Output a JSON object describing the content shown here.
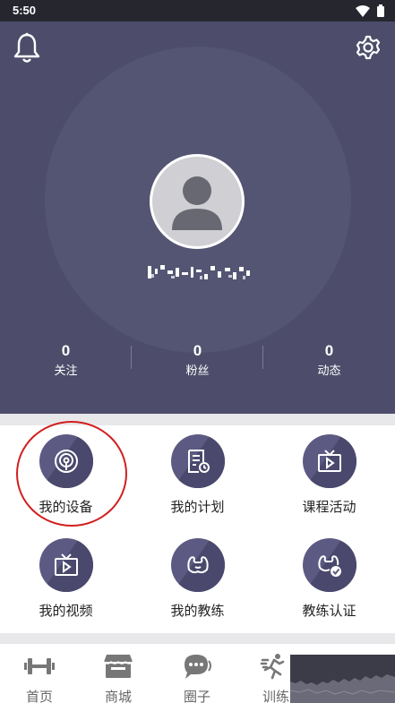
{
  "status_bar": {
    "time": "5:50"
  },
  "profile": {
    "stats": [
      {
        "value": "0",
        "label": "关注"
      },
      {
        "value": "0",
        "label": "粉丝"
      },
      {
        "value": "0",
        "label": "动态"
      }
    ]
  },
  "menu": [
    {
      "label": "我的设备",
      "icon": "device-signal-icon"
    },
    {
      "label": "我的计划",
      "icon": "plan-document-icon"
    },
    {
      "label": "课程活动",
      "icon": "course-tv-icon"
    },
    {
      "label": "我的视频",
      "icon": "video-tv-icon"
    },
    {
      "label": "我的教练",
      "icon": "coach-muscle-icon"
    },
    {
      "label": "教练认证",
      "icon": "coach-certify-icon"
    }
  ],
  "bottom_nav": [
    {
      "label": "首页",
      "icon": "dumbbell-icon"
    },
    {
      "label": "商城",
      "icon": "store-icon"
    },
    {
      "label": "圈子",
      "icon": "chat-bubble-icon"
    },
    {
      "label": "训练",
      "icon": "running-icon"
    }
  ]
}
